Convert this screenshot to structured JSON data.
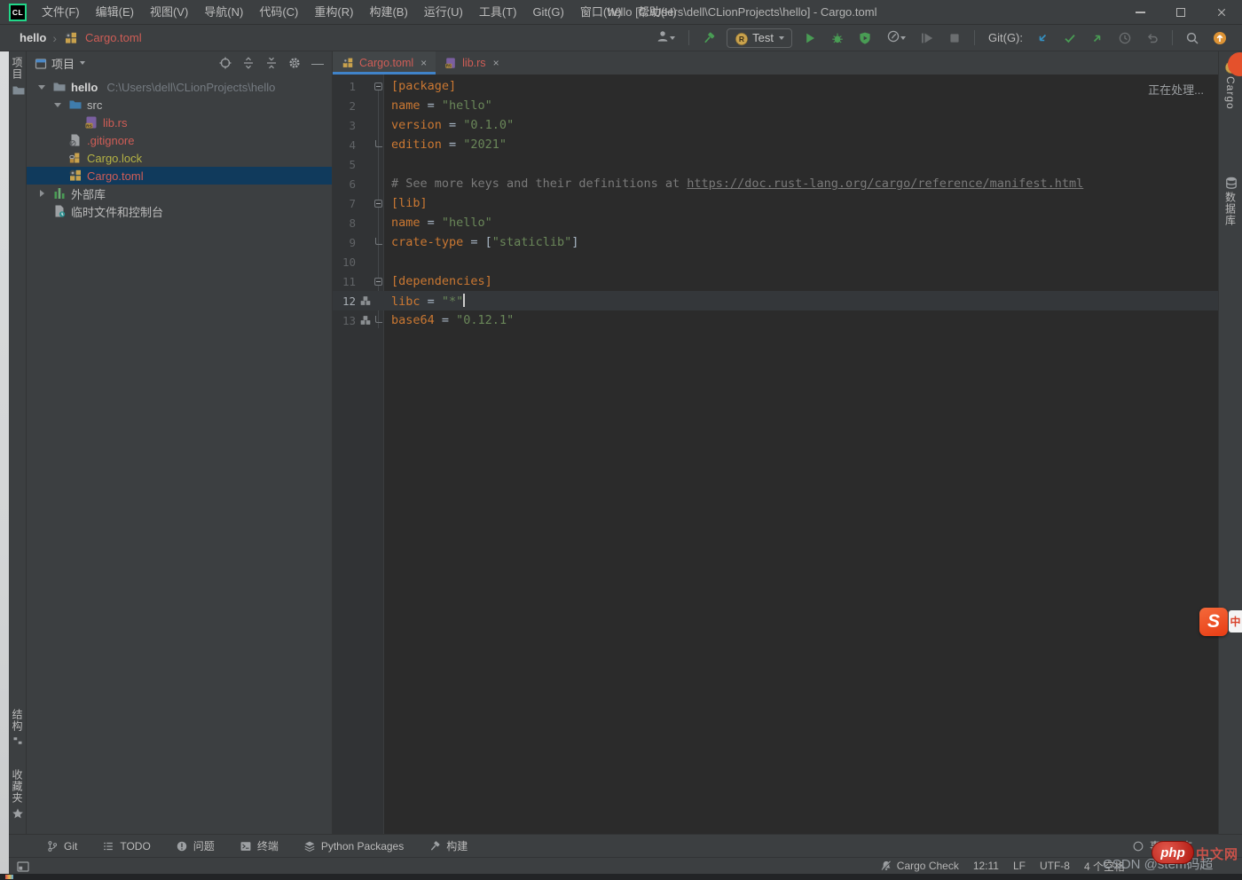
{
  "colors": {
    "accent_blue": "#4083c9",
    "vcs_modified_red": "#cf5d56",
    "vcs_olive": "#b5b344",
    "key_orange": "#cb7832",
    "string_green": "#6a8759",
    "run_green": "#499c54",
    "panel_bg": "#3c3f41",
    "editor_bg": "#2b2b2b",
    "selection_blue": "#103a5c",
    "notification_orange": "#e4512c"
  },
  "titlebar": {
    "title": "hello [C:\\Users\\dell\\CLionProjects\\hello] - Cargo.toml",
    "logo": "CL",
    "menu": [
      {
        "id": "file",
        "label": "文件(F)"
      },
      {
        "id": "edit",
        "label": "编辑(E)"
      },
      {
        "id": "view",
        "label": "视图(V)"
      },
      {
        "id": "navigate",
        "label": "导航(N)"
      },
      {
        "id": "code",
        "label": "代码(C)"
      },
      {
        "id": "refactor",
        "label": "重构(R)"
      },
      {
        "id": "build",
        "label": "构建(B)"
      },
      {
        "id": "run",
        "label": "运行(U)"
      },
      {
        "id": "tools",
        "label": "工具(T)"
      },
      {
        "id": "git",
        "label": "Git(G)"
      },
      {
        "id": "window",
        "label": "窗口(W)"
      },
      {
        "id": "help",
        "label": "帮助(H)"
      }
    ]
  },
  "toolbar": {
    "breadcrumb": {
      "project": "hello",
      "file": "Cargo.toml"
    },
    "run_config_label": "Test",
    "git_label": "Git(G):"
  },
  "left_stripe": {
    "project": "项目",
    "structure": "结构",
    "favorites": "收藏夹"
  },
  "right_stripe": {
    "cargo": "Cargo",
    "database": "数据库"
  },
  "project_panel": {
    "title": "项目",
    "tree": [
      {
        "id": "hello",
        "indent": 0,
        "chevron": "down",
        "icon": "folder",
        "label": "hello",
        "bold": true,
        "path": "C:\\Users\\dell\\CLionProjects\\hello"
      },
      {
        "id": "src",
        "indent": 1,
        "chevron": "down",
        "icon": "folder-src",
        "label": "src"
      },
      {
        "id": "lib-rs",
        "indent": 2,
        "chevron": "",
        "icon": "rust-file",
        "label": "lib.rs",
        "color": "c-red"
      },
      {
        "id": "gitignore",
        "indent": 1,
        "chevron": "",
        "icon": "gitignore",
        "label": ".gitignore",
        "color": "c-red"
      },
      {
        "id": "cargo-lock",
        "indent": 1,
        "chevron": "",
        "icon": "cargo-lock",
        "label": "Cargo.lock",
        "color": "c-olive"
      },
      {
        "id": "cargo-toml",
        "indent": 1,
        "chevron": "",
        "icon": "cargo-toml",
        "label": "Cargo.toml",
        "color": "c-red",
        "selected": true
      },
      {
        "id": "external-libraries",
        "indent": 0,
        "chevron": "right",
        "icon": "library",
        "label": "外部库"
      },
      {
        "id": "scratches",
        "indent": 0,
        "chevron": "",
        "icon": "scratch",
        "label": "临时文件和控制台"
      }
    ]
  },
  "editor": {
    "tabs": [
      {
        "id": "cargo-toml",
        "icon": "cargo-toml",
        "label": "Cargo.toml",
        "active": true
      },
      {
        "id": "lib-rs",
        "icon": "rust-file",
        "label": "lib.rs",
        "active": false
      }
    ],
    "processing": "正在处理...",
    "lines": [
      {
        "num": "1",
        "fold": "start",
        "icon": "",
        "current": false,
        "caret": false,
        "tokens": [
          [
            "[package]",
            "orange"
          ]
        ]
      },
      {
        "num": "2",
        "fold": "",
        "icon": "",
        "current": false,
        "caret": false,
        "tokens": [
          [
            "name",
            "orange"
          ],
          [
            " = ",
            "plain"
          ],
          [
            "\"hello\"",
            "string"
          ]
        ]
      },
      {
        "num": "3",
        "fold": "",
        "icon": "",
        "current": false,
        "caret": false,
        "tokens": [
          [
            "version",
            "orange"
          ],
          [
            " = ",
            "plain"
          ],
          [
            "\"0.1.0\"",
            "string"
          ]
        ]
      },
      {
        "num": "4",
        "fold": "end",
        "icon": "",
        "current": false,
        "caret": false,
        "tokens": [
          [
            "edition",
            "orange"
          ],
          [
            " = ",
            "plain"
          ],
          [
            "\"2021\"",
            "string"
          ]
        ]
      },
      {
        "num": "5",
        "fold": "",
        "icon": "",
        "current": false,
        "caret": false,
        "tokens": []
      },
      {
        "num": "6",
        "fold": "",
        "icon": "",
        "current": false,
        "caret": false,
        "tokens": [
          [
            "# See more keys and their definitions at ",
            "comment"
          ],
          [
            "https://doc.rust-lang.org/cargo/reference/manifest.html",
            "link"
          ]
        ]
      },
      {
        "num": "7",
        "fold": "start",
        "icon": "",
        "current": false,
        "caret": false,
        "tokens": [
          [
            "[lib]",
            "orange"
          ]
        ]
      },
      {
        "num": "8",
        "fold": "",
        "icon": "",
        "current": false,
        "caret": false,
        "tokens": [
          [
            "name",
            "orange"
          ],
          [
            " = ",
            "plain"
          ],
          [
            "\"hello\"",
            "string"
          ]
        ]
      },
      {
        "num": "9",
        "fold": "end",
        "icon": "",
        "current": false,
        "caret": false,
        "tokens": [
          [
            "crate-type",
            "orange"
          ],
          [
            " = [",
            "plain"
          ],
          [
            "\"staticlib\"",
            "string"
          ],
          [
            "]",
            "plain"
          ]
        ]
      },
      {
        "num": "10",
        "fold": "",
        "icon": "",
        "current": false,
        "caret": false,
        "tokens": []
      },
      {
        "num": "11",
        "fold": "start",
        "icon": "",
        "current": false,
        "caret": false,
        "tokens": [
          [
            "[dependencies]",
            "orange"
          ]
        ]
      },
      {
        "num": "12",
        "fold": "",
        "icon": "crates",
        "current": true,
        "caret": true,
        "tokens": [
          [
            "libc",
            "orange"
          ],
          [
            " = ",
            "plain"
          ],
          [
            "\"*\"",
            "string"
          ]
        ]
      },
      {
        "num": "13",
        "fold": "end",
        "icon": "crates",
        "current": false,
        "caret": false,
        "tokens": [
          [
            "base64",
            "orange"
          ],
          [
            " = ",
            "plain"
          ],
          [
            "\"0.12.1\"",
            "string"
          ]
        ]
      }
    ]
  },
  "bottom_bar": {
    "items": [
      {
        "id": "git",
        "icon": "branch",
        "label": "Git"
      },
      {
        "id": "todo",
        "icon": "todo",
        "label": "TODO"
      },
      {
        "id": "problems",
        "icon": "problem",
        "label": "问题"
      },
      {
        "id": "terminal",
        "icon": "terminal",
        "label": "终端"
      },
      {
        "id": "python-packages",
        "icon": "pypkg",
        "label": "Python Packages"
      },
      {
        "id": "build",
        "icon": "build",
        "label": "构建"
      }
    ],
    "event_log": {
      "id": "event-log",
      "icon": "balloon",
      "label": "事件日志"
    }
  },
  "statusbar": {
    "items": [
      {
        "id": "cargo-check",
        "icon": "bell-muted",
        "label": "Cargo Check"
      },
      {
        "id": "line-col",
        "icon": "",
        "label": "12:11"
      },
      {
        "id": "line-separator",
        "icon": "",
        "label": "LF"
      },
      {
        "id": "encoding",
        "icon": "",
        "label": "UTF-8"
      },
      {
        "id": "indent",
        "icon": "",
        "label": "4 个空格"
      }
    ]
  },
  "watermarks": {
    "csdn": "CSDN @stem码超",
    "php": "php",
    "php_suffix": "中文网",
    "s_logo": "S",
    "s_bubble": "中"
  }
}
